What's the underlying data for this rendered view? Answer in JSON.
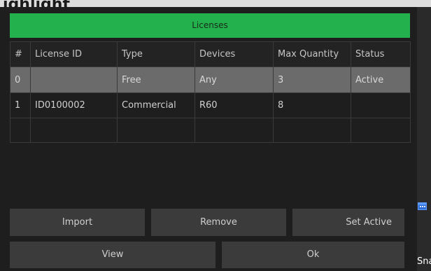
{
  "window": {
    "title": "ighlight"
  },
  "dialog": {
    "header": "Licenses",
    "table": {
      "columns": [
        "#",
        "License ID",
        "Type",
        "Devices",
        "Max Quantity",
        "Status"
      ],
      "rows": [
        [
          "0",
          "",
          "Free",
          "Any",
          "3",
          "Active"
        ],
        [
          "1",
          "ID0100002",
          "Commercial",
          "R60",
          "8",
          ""
        ],
        [
          "",
          "",
          "",
          "",
          "",
          ""
        ]
      ]
    },
    "buttons": {
      "import": "Import",
      "remove": "Remove",
      "set_active": "Set Active",
      "view": "View",
      "ok": "Ok"
    }
  },
  "side": {
    "snip_text": "Sna",
    "icon": "calendar-icon"
  },
  "colors": {
    "header": "#22b14c",
    "dialog_bg": "#1e1e1e",
    "selected_row": "#6b6b6b",
    "button": "#3b3b3b"
  }
}
